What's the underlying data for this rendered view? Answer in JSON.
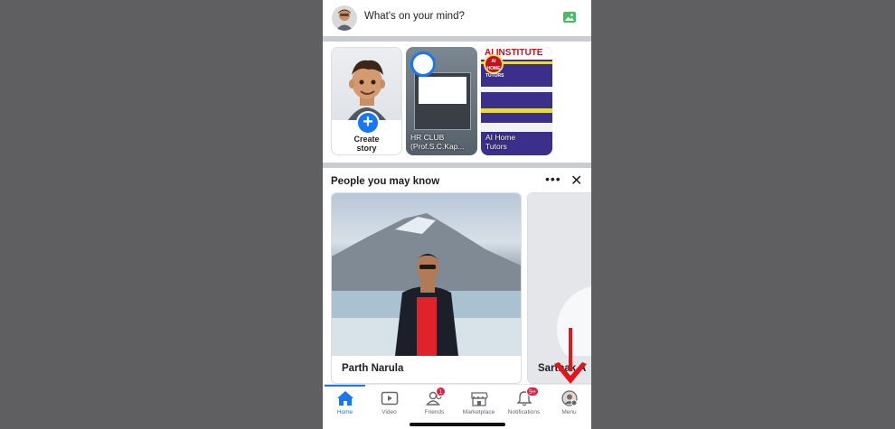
{
  "composer": {
    "prompt": "What's on your mind?",
    "avatar_icon": "user-avatar-icon",
    "photo_icon": "photo-icon",
    "photo_icon_color": "#45bd62"
  },
  "stories": [
    {
      "type": "create",
      "label_line1": "Create",
      "label_line2": "story",
      "accent": "#1877f2"
    },
    {
      "type": "story",
      "title_line1": "HR CLUB",
      "title_line2": "(Prof.S.C.Kap..."
    },
    {
      "type": "story",
      "title_line1": "AI Home",
      "title_line2": "Tutors",
      "banner": "AI INSTITUTE",
      "logo_line1": "AI",
      "logo_line2": "HOME",
      "logo_line3": "TUTORS"
    }
  ],
  "pymk": {
    "heading": "People you may know",
    "more_icon": "more-icon",
    "close_icon": "close-icon",
    "people": [
      {
        "name": "Parth Narula"
      },
      {
        "name": "Sarthak A"
      }
    ]
  },
  "tabbar": {
    "accent": "#1877f2",
    "tabs": [
      {
        "label": "Home",
        "icon": "home-icon",
        "active": true
      },
      {
        "label": "Video",
        "icon": "video-icon"
      },
      {
        "label": "Friends",
        "icon": "friends-icon",
        "badge": "1"
      },
      {
        "label": "Marketplace",
        "icon": "marketplace-icon"
      },
      {
        "label": "Notifications",
        "icon": "bell-icon",
        "badge": "9+"
      },
      {
        "label": "Menu",
        "icon": "menu-avatar-icon"
      }
    ]
  },
  "annotation": {
    "icon": "red-down-arrow-icon",
    "color": "#e4141b"
  }
}
